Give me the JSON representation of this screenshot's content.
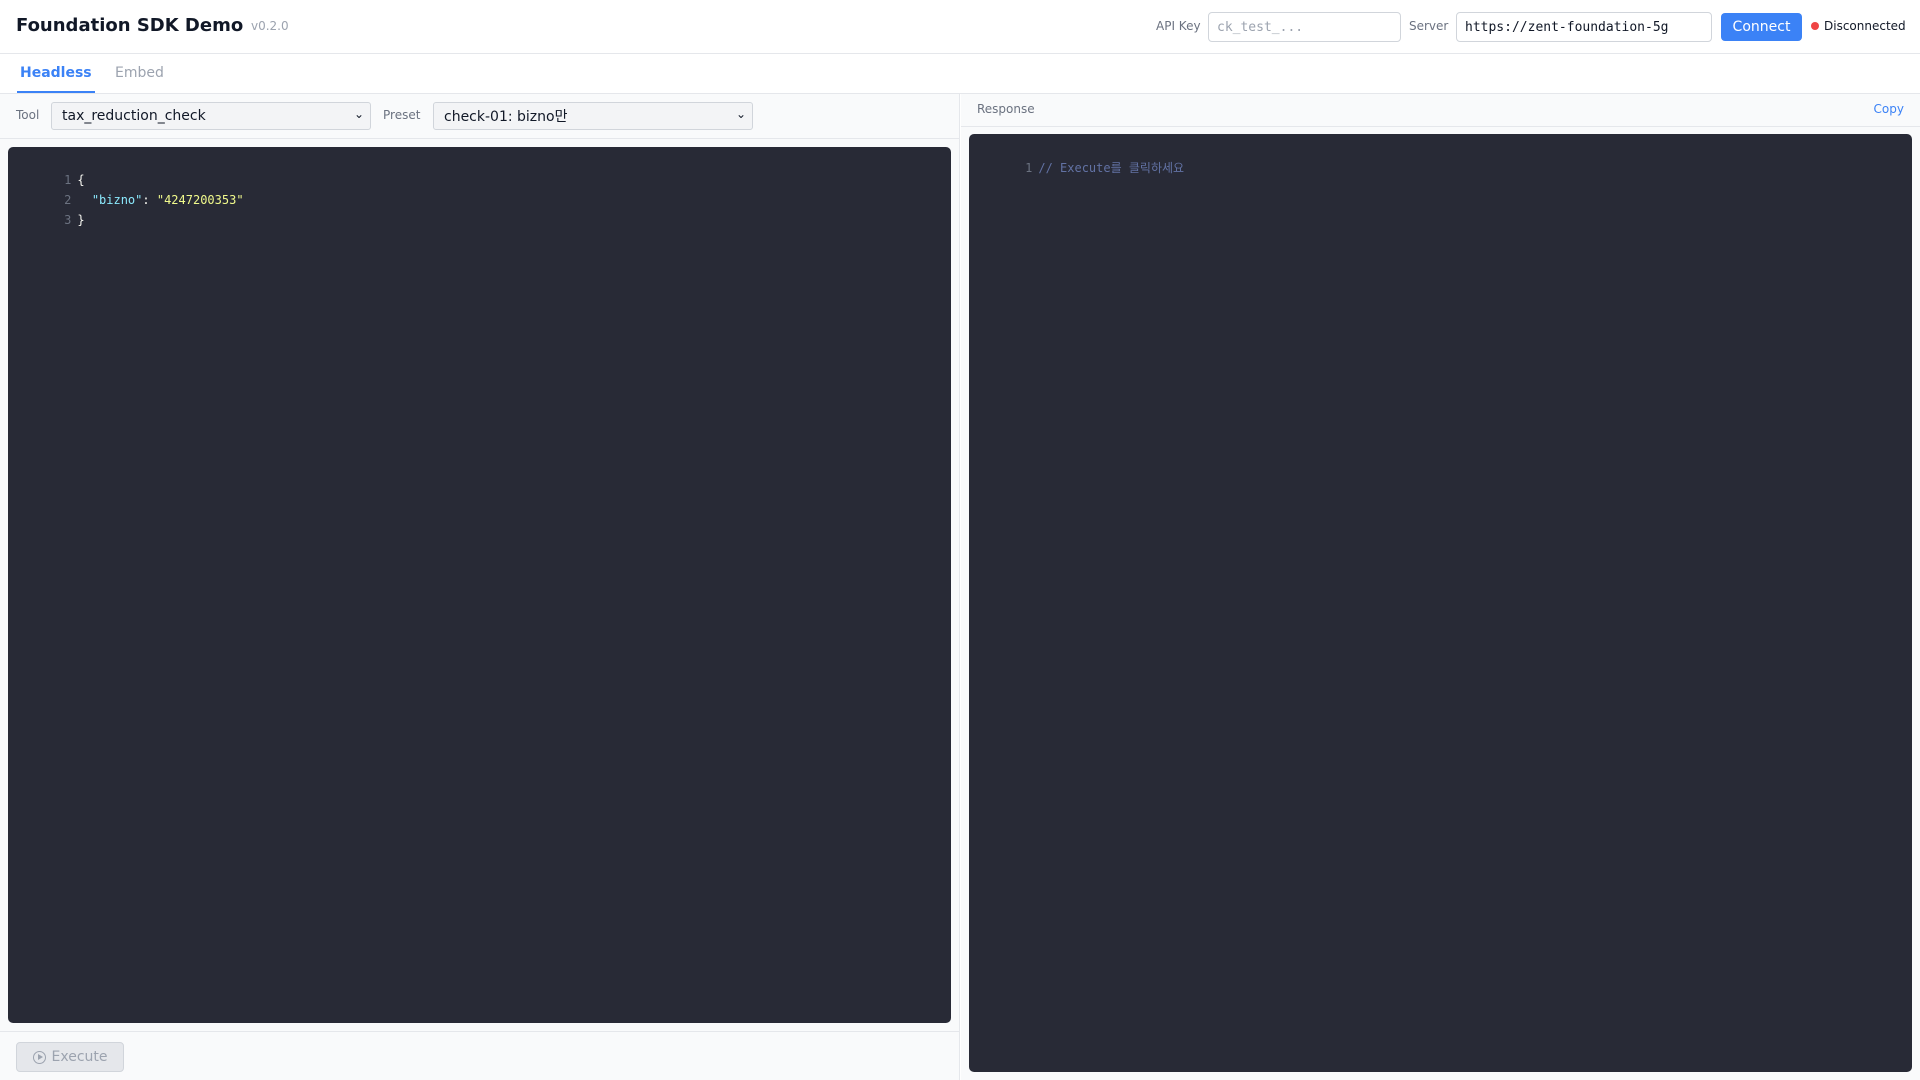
{
  "header": {
    "title": "Foundation SDK Demo",
    "version": "v0.2.0",
    "api_key_label": "API Key",
    "api_key_placeholder": "ck_test_...",
    "api_key_value": "",
    "server_label": "Server",
    "server_value": "https://zent-foundation-5g",
    "connect_label": "Connect",
    "status_text": "Disconnected",
    "status_color": "#ef4444",
    "accent_color": "#3b82f6"
  },
  "tabs": [
    {
      "label": "Headless",
      "active": true
    },
    {
      "label": "Embed",
      "active": false
    }
  ],
  "request": {
    "tool_label": "Tool",
    "tool_value": "tax_reduction_check",
    "preset_label": "Preset",
    "preset_value": "check-01: bizno만",
    "line_numbers": [
      "1",
      "2",
      "3"
    ],
    "code": {
      "open_brace": "{",
      "key": "\"bizno\"",
      "colon": ": ",
      "value": "\"4247200353\"",
      "close_brace": "}"
    },
    "execute_label": "Execute",
    "execute_icon": "play-circle-icon"
  },
  "response": {
    "title": "Response",
    "copy_label": "Copy",
    "line_numbers": [
      "1"
    ],
    "placeholder_comment": "// Execute를 클릭하세요"
  }
}
